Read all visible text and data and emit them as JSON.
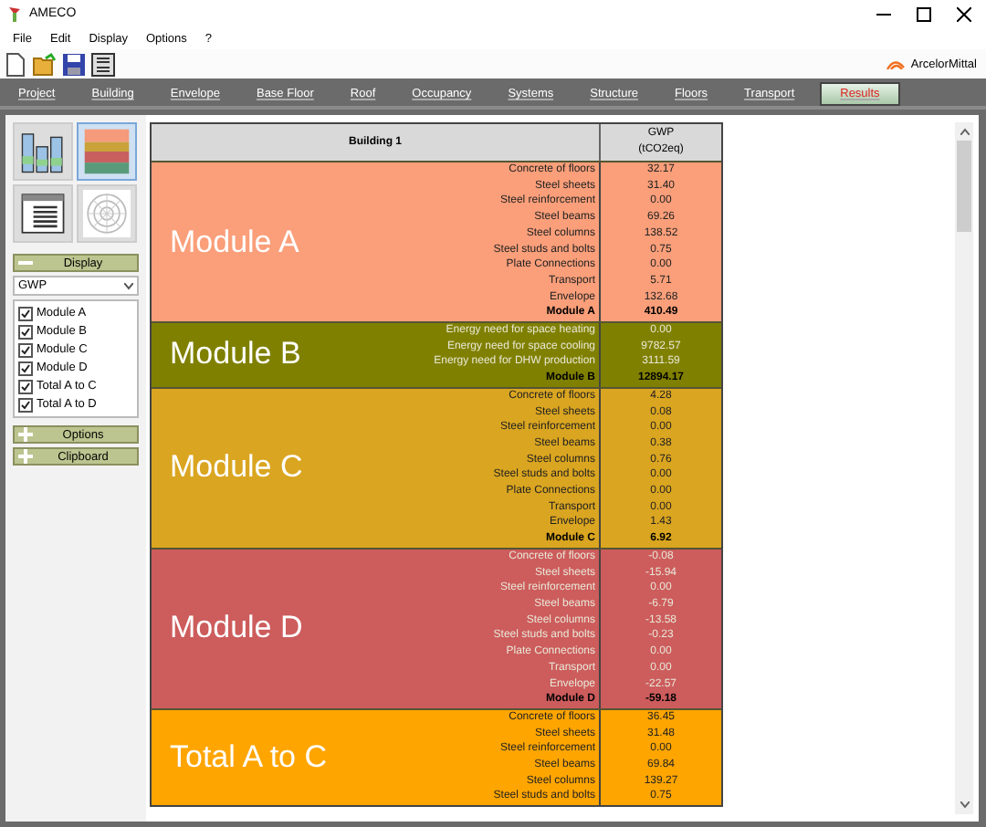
{
  "window": {
    "title": "AMECO"
  },
  "menu": [
    "File",
    "Edit",
    "Display",
    "Options",
    "?"
  ],
  "logo": "ArcelorMittal",
  "tabs": [
    {
      "label": "Project",
      "selected": false
    },
    {
      "label": "Building",
      "selected": false
    },
    {
      "label": "Envelope",
      "selected": false
    },
    {
      "label": "Base Floor",
      "selected": false
    },
    {
      "label": "Roof",
      "selected": false
    },
    {
      "label": "Occupancy",
      "selected": false
    },
    {
      "label": "Systems",
      "selected": false
    },
    {
      "label": "Structure",
      "selected": false
    },
    {
      "label": "Floors",
      "selected": false
    },
    {
      "label": "Transport",
      "selected": false
    },
    {
      "label": "Results",
      "selected": true
    }
  ],
  "sidebar": {
    "views": [
      {
        "kind": "bars",
        "selected": false
      },
      {
        "kind": "table",
        "selected": true
      },
      {
        "kind": "list",
        "selected": false
      },
      {
        "kind": "radar",
        "selected": false
      }
    ],
    "panels": [
      {
        "title": "Display",
        "expanded": true,
        "dropdown": "GWP",
        "options": [
          {
            "label": "Module A",
            "checked": true
          },
          {
            "label": "Module B",
            "checked": true
          },
          {
            "label": "Module C",
            "checked": true
          },
          {
            "label": "Module D",
            "checked": true
          },
          {
            "label": "Total A to C",
            "checked": true
          },
          {
            "label": "Total A to D",
            "checked": true
          }
        ]
      },
      {
        "title": "Options",
        "expanded": false
      },
      {
        "title": "Clipboard",
        "expanded": false
      }
    ]
  },
  "table": {
    "header": "Building 1",
    "value_header": [
      "GWP",
      "(tCO2eq)"
    ],
    "sections": [
      {
        "name": "Module A",
        "color": "#fa9f7a",
        "rows": [
          {
            "kind": "item",
            "label": "Concrete of floors",
            "value": "32.17"
          },
          {
            "kind": "item",
            "label": "Steel sheets",
            "value": "31.40"
          },
          {
            "kind": "item",
            "label": "Steel reinforcement",
            "value": "0.00"
          },
          {
            "kind": "item",
            "label": "Steel beams",
            "value": "69.26"
          },
          {
            "kind": "item",
            "label": "Steel columns",
            "value": "138.52"
          },
          {
            "kind": "item",
            "label": "Steel studs and bolts",
            "value": "0.75"
          },
          {
            "kind": "item",
            "label": "Plate Connections",
            "value": "0.00"
          },
          {
            "kind": "item",
            "label": "Transport",
            "value": "5.71"
          },
          {
            "kind": "item",
            "label": "Envelope",
            "value": "132.68"
          },
          {
            "kind": "total",
            "label": "Module A",
            "value": "410.49"
          }
        ]
      },
      {
        "name": "Module B",
        "color": "#808000",
        "rows": [
          {
            "kind": "item",
            "label": "Energy need for space heating",
            "value": "0.00"
          },
          {
            "kind": "item",
            "label": "Energy need for space cooling",
            "value": "9782.57"
          },
          {
            "kind": "item",
            "label": "Energy need for DHW production",
            "value": "3111.59"
          },
          {
            "kind": "total",
            "label": "Module B",
            "value": "12894.17"
          }
        ]
      },
      {
        "name": "Module C",
        "color": "#daa520",
        "rows": [
          {
            "kind": "item",
            "label": "Concrete of floors",
            "value": "4.28"
          },
          {
            "kind": "item",
            "label": "Steel sheets",
            "value": "0.08"
          },
          {
            "kind": "item",
            "label": "Steel reinforcement",
            "value": "0.00"
          },
          {
            "kind": "item",
            "label": "Steel beams",
            "value": "0.38"
          },
          {
            "kind": "item",
            "label": "Steel columns",
            "value": "0.76"
          },
          {
            "kind": "item",
            "label": "Steel studs and bolts",
            "value": "0.00"
          },
          {
            "kind": "item",
            "label": "Plate Connections",
            "value": "0.00"
          },
          {
            "kind": "item",
            "label": "Transport",
            "value": "0.00"
          },
          {
            "kind": "item",
            "label": "Envelope",
            "value": "1.43"
          },
          {
            "kind": "total",
            "label": "Module C",
            "value": "6.92"
          }
        ]
      },
      {
        "name": "Module D",
        "color": "#cd5c5c",
        "rows": [
          {
            "kind": "item",
            "label": "Concrete of floors",
            "value": "-0.08"
          },
          {
            "kind": "item",
            "label": "Steel sheets",
            "value": "-15.94"
          },
          {
            "kind": "item",
            "label": "Steel reinforcement",
            "value": "0.00"
          },
          {
            "kind": "item",
            "label": "Steel beams",
            "value": "-6.79"
          },
          {
            "kind": "item",
            "label": "Steel columns",
            "value": "-13.58"
          },
          {
            "kind": "item",
            "label": "Steel studs and bolts",
            "value": "-0.23"
          },
          {
            "kind": "item",
            "label": "Plate Connections",
            "value": "0.00"
          },
          {
            "kind": "item",
            "label": "Transport",
            "value": "0.00"
          },
          {
            "kind": "item",
            "label": "Envelope",
            "value": "-22.57"
          },
          {
            "kind": "total",
            "label": "Module D",
            "value": "-59.18"
          }
        ]
      },
      {
        "name": "Total A to C",
        "color": "#ffa500",
        "rows": [
          {
            "kind": "item",
            "label": "Concrete of floors",
            "value": "36.45"
          },
          {
            "kind": "item",
            "label": "Steel sheets",
            "value": "31.48"
          },
          {
            "kind": "item",
            "label": "Steel reinforcement",
            "value": "0.00"
          },
          {
            "kind": "item",
            "label": "Steel beams",
            "value": "69.84"
          },
          {
            "kind": "item",
            "label": "Steel columns",
            "value": "139.27"
          },
          {
            "kind": "item",
            "label": "Steel studs and bolts",
            "value": "0.75"
          }
        ]
      }
    ]
  }
}
